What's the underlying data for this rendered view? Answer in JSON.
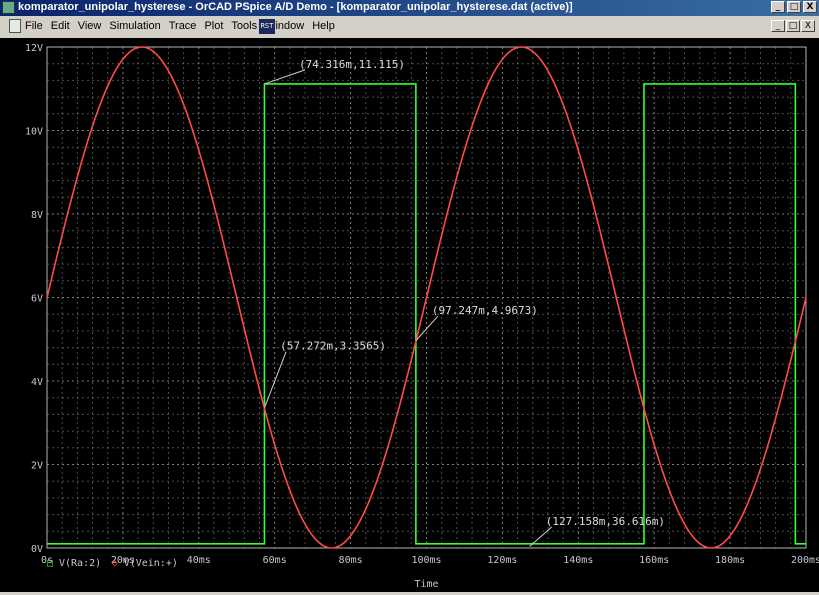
{
  "window": {
    "title": "komparator_unipolar_hysterese - OrCAD PSpice A/D Demo  - [komparator_unipolar_hysterese.dat (active)]",
    "buttons": [
      "_",
      "□",
      "X"
    ]
  },
  "menubar": {
    "items": [
      "File",
      "Edit",
      "View",
      "Simulation",
      "Trace",
      "Plot",
      "Tools",
      "Window",
      "Help"
    ],
    "doc_buttons": [
      "_",
      "□",
      "X"
    ]
  },
  "colors": {
    "background": "#000000",
    "grid": "#8c8c8c",
    "axis_text": "#c8c8c8",
    "sine": "#ff4a4a",
    "square": "#33ff33"
  },
  "chart_data": {
    "type": "line",
    "xlabel": "Time",
    "ylabel": "",
    "xlim": [
      0,
      200
    ],
    "ylim": [
      0,
      12
    ],
    "x_ticks": [
      {
        "v": 0,
        "label": "0s"
      },
      {
        "v": 20,
        "label": "20ms"
      },
      {
        "v": 40,
        "label": "40ms"
      },
      {
        "v": 60,
        "label": "60ms"
      },
      {
        "v": 80,
        "label": "80ms"
      },
      {
        "v": 100,
        "label": "100ms"
      },
      {
        "v": 120,
        "label": "120ms"
      },
      {
        "v": 140,
        "label": "140ms"
      },
      {
        "v": 160,
        "label": "160ms"
      },
      {
        "v": 180,
        "label": "180ms"
      },
      {
        "v": 200,
        "label": "200ms"
      }
    ],
    "y_ticks": [
      {
        "v": 0,
        "label": "0V"
      },
      {
        "v": 2,
        "label": "2V"
      },
      {
        "v": 4,
        "label": "4V"
      },
      {
        "v": 6,
        "label": "6V"
      },
      {
        "v": 8,
        "label": "8V"
      },
      {
        "v": 10,
        "label": "10V"
      },
      {
        "v": 12,
        "label": "12V"
      }
    ],
    "grid": true,
    "series": [
      {
        "name": "V(Ra:2)",
        "marker": "□",
        "kind": "square",
        "points": [
          [
            0,
            0.1
          ],
          [
            57.3,
            0.1
          ],
          [
            57.3,
            11.115
          ],
          [
            97.2,
            11.115
          ],
          [
            97.2,
            0.1
          ],
          [
            157.3,
            0.1
          ],
          [
            157.3,
            11.115
          ],
          [
            197.2,
            11.115
          ],
          [
            197.2,
            0.1
          ],
          [
            200,
            0.1
          ]
        ]
      },
      {
        "name": "V(Vein:+)",
        "marker": "◇",
        "kind": "sine",
        "offset": 6,
        "amplitude": 6,
        "period_ms": 100
      }
    ],
    "annotations": [
      {
        "text": "(74.316m,11.115)",
        "point": [
          57.3,
          11.115
        ],
        "anchor": [
          68,
          11.5
        ]
      },
      {
        "text": "(97.247m,4.9673)",
        "point": [
          97.2,
          4.9673
        ],
        "anchor": [
          103,
          5.6
        ]
      },
      {
        "text": "(57.272m,3.3565)",
        "point": [
          57.3,
          3.3565
        ],
        "anchor": [
          63,
          4.75
        ]
      },
      {
        "text": "(127.158m,36.616m)",
        "point": [
          127.2,
          0.04
        ],
        "anchor": [
          133,
          0.55
        ]
      }
    ]
  }
}
